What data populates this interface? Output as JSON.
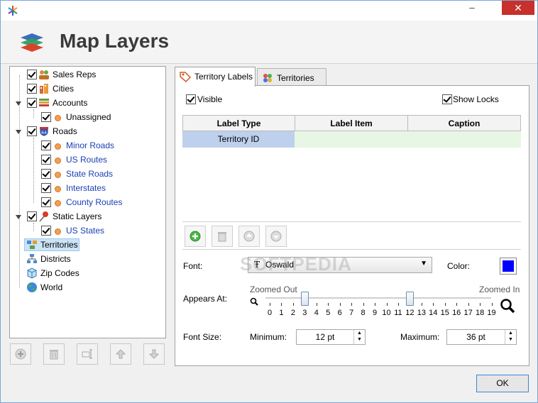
{
  "window": {
    "title": "",
    "min_symbol": "–",
    "close_symbol": "✕"
  },
  "header": {
    "title": "Map Layers"
  },
  "tree": [
    {
      "label": "Sales Reps",
      "icon": "sales-reps-icon",
      "checked": true
    },
    {
      "label": "Cities",
      "icon": "cities-icon",
      "checked": true
    },
    {
      "label": "Accounts",
      "icon": "accounts-icon",
      "checked": true,
      "expanded": true
    },
    {
      "label": "Unassigned",
      "icon": "dot-icon",
      "checked": true
    },
    {
      "label": "Roads",
      "icon": "roads-icon",
      "checked": true,
      "expanded": true
    },
    {
      "label": "Minor Roads",
      "icon": "dot-icon",
      "checked": true
    },
    {
      "label": "US Routes",
      "icon": "dot-icon",
      "checked": true
    },
    {
      "label": "State Roads",
      "icon": "dot-icon",
      "checked": true
    },
    {
      "label": "Interstates",
      "icon": "dot-icon",
      "checked": true
    },
    {
      "label": "County Routes",
      "icon": "dot-icon",
      "checked": true
    },
    {
      "label": "Static Layers",
      "icon": "pushpin-icon",
      "checked": true,
      "expanded": true
    },
    {
      "label": "US States",
      "icon": "dot-icon",
      "checked": true
    },
    {
      "label": "Territories",
      "icon": "territories-icon",
      "selected": true
    },
    {
      "label": "Districts",
      "icon": "districts-icon"
    },
    {
      "label": "Zip Codes",
      "icon": "zip-codes-icon"
    },
    {
      "label": "World",
      "icon": "globe-icon"
    }
  ],
  "tabs": [
    {
      "label": "Territory Labels",
      "icon": "tag-icon",
      "active": true
    },
    {
      "label": "Territories",
      "icon": "territories-icon",
      "active": false
    }
  ],
  "panel": {
    "visible_label": "Visible",
    "show_locks_label": "Show Locks",
    "table": {
      "columns": [
        "Label Type",
        "Label Item",
        "Caption"
      ],
      "rows": [
        [
          "Territory ID",
          "",
          ""
        ]
      ]
    },
    "font_label": "Font:",
    "font_value": "Oswald",
    "color_label": "Color:",
    "color_value": "#0000ff",
    "appears_label": "Appears At:",
    "zoomed_out_label": "Zoomed Out",
    "zoomed_in_label": "Zoomed In",
    "ticks": [
      "0",
      "1",
      "2",
      "3",
      "4",
      "5",
      "6",
      "7",
      "8",
      "9",
      "10",
      "11",
      "12",
      "13",
      "14",
      "15",
      "16",
      "17",
      "18",
      "19"
    ],
    "range_min": 3,
    "range_max": 12,
    "font_size_label": "Font Size:",
    "minimum_label": "Minimum:",
    "minimum_value": "12 pt",
    "maximum_label": "Maximum:",
    "maximum_value": "36 pt"
  },
  "watermark": "SOFTPEDIA",
  "ok_label": "OK"
}
